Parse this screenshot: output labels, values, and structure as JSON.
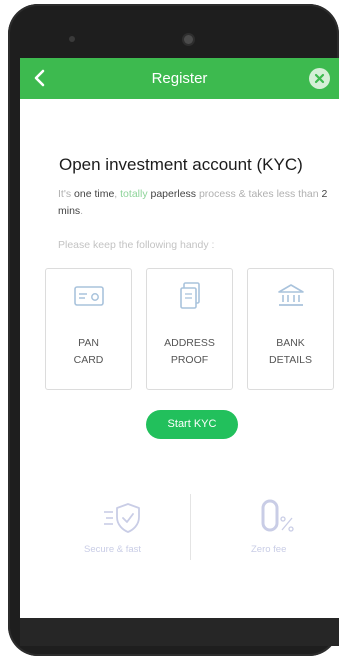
{
  "header": {
    "title": "Register"
  },
  "kyc": {
    "title": "Open investment account (KYC)",
    "desc_1": "It's ",
    "desc_2": "one time",
    "desc_3": ", ",
    "desc_4": "totally",
    "desc_5": " ",
    "desc_6": "paperless",
    "desc_7": " process & takes less than ",
    "desc_8": "2 mins",
    "desc_9": ".",
    "handy_text": "Please keep the following handy :"
  },
  "documents": [
    {
      "label_line1": "PAN",
      "label_line2": "CARD",
      "icon": "card-icon"
    },
    {
      "label_line1": "ADDRESS",
      "label_line2": "PROOF",
      "icon": "document-icon"
    },
    {
      "label_line1": "BANK",
      "label_line2": "DETAILS",
      "icon": "bank-icon"
    }
  ],
  "start_button": "Start KYC",
  "features": [
    {
      "label": "Secure & fast",
      "icon": "shield-check-icon"
    },
    {
      "label": "Zero fee",
      "icon": "zero-percent-icon"
    }
  ],
  "colors": {
    "header_green": "#3dba4f",
    "button_green": "#22c05c",
    "icon_blue": "#a9c3dc",
    "feature_lavender": "#c9cde6"
  }
}
